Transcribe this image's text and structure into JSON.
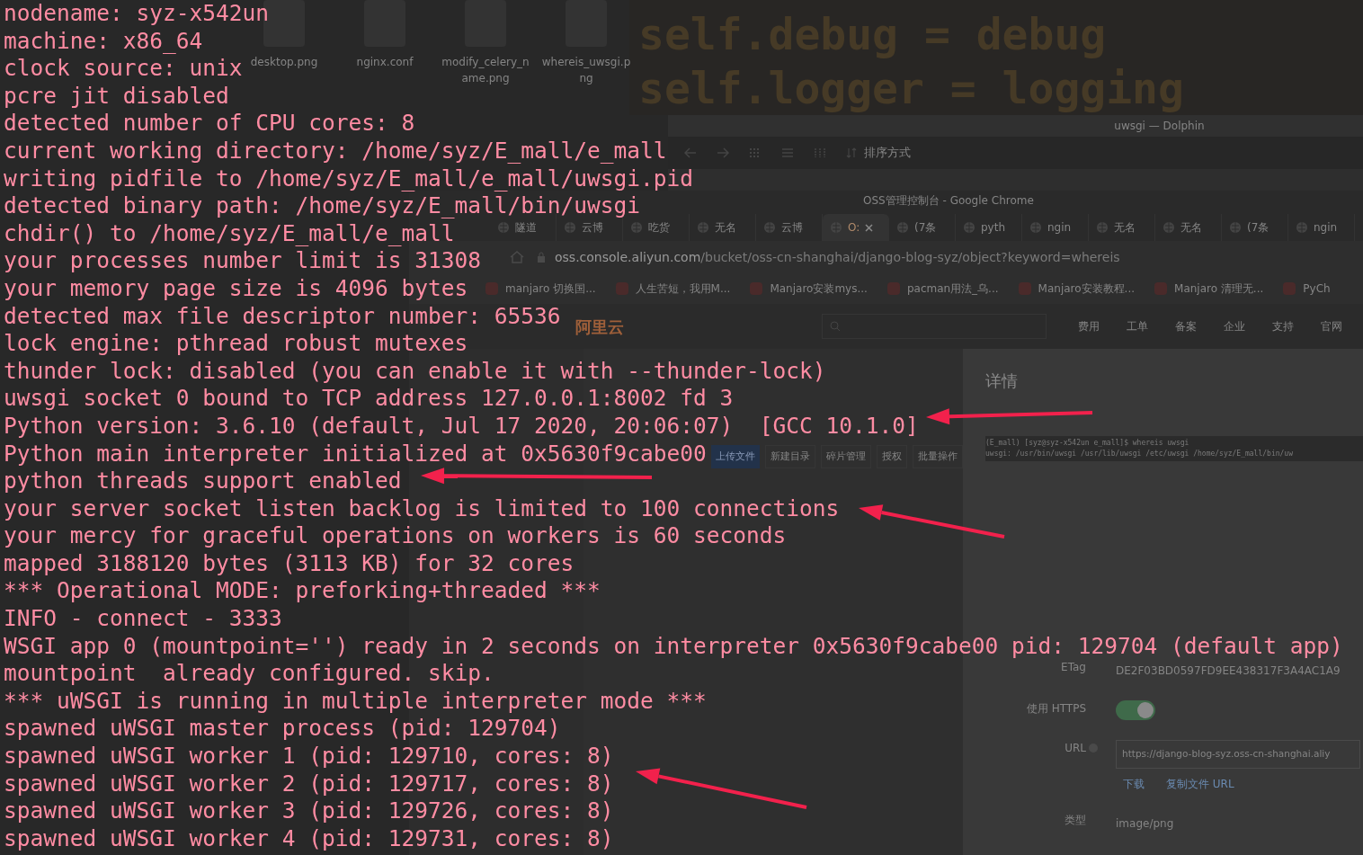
{
  "desktop": {
    "files": [
      {
        "name": "desktop.png"
      },
      {
        "name": "nginx.conf"
      },
      {
        "name": "modify_celery_name.png"
      },
      {
        "name": "whereis_uwsgi.png"
      }
    ]
  },
  "editor": {
    "code_lines": [
      "self.debug = debug",
      "self.logger = logging"
    ]
  },
  "file_manager": {
    "title": "uwsgi — Dolphin",
    "sort_label": "排序方式"
  },
  "browser": {
    "title": "OSS管理控制台 - Google Chrome",
    "tabs": [
      {
        "label": "隧道",
        "selected": false
      },
      {
        "label": "云博",
        "selected": false
      },
      {
        "label": "吃货",
        "selected": false
      },
      {
        "label": "无名",
        "selected": false
      },
      {
        "label": "云博",
        "selected": false
      },
      {
        "label": "O:",
        "selected": true
      },
      {
        "label": "(7条",
        "selected": false
      },
      {
        "label": "pyth",
        "selected": false
      },
      {
        "label": "ngin",
        "selected": false
      },
      {
        "label": "无名",
        "selected": false
      },
      {
        "label": "无名",
        "selected": false
      },
      {
        "label": "(7条",
        "selected": false
      },
      {
        "label": "ngin",
        "selected": false
      }
    ],
    "url_host": "oss.console.aliyun.com",
    "url_path": "/bucket/oss-cn-shanghai/django-blog-syz/object?keyword=whereis",
    "bookmarks": [
      "manjaro 切换国...",
      "人生苦短，我用M...",
      "Manjaro安装mys...",
      "pacman用法_乌...",
      "Manjaro安装教程...",
      "Manjaro 清理无...",
      "PyCh"
    ]
  },
  "console": {
    "logo": "阿里云",
    "nav": [
      "费用",
      "工单",
      "备案",
      "企业",
      "支持",
      "官网"
    ],
    "toolbar": [
      "上传文件",
      "新建目录",
      "碎片管理",
      "授权",
      "批量操作"
    ],
    "detail": {
      "title": "详情",
      "preview_lines": [
        "(E_mall) [syz@syz-x542un e_mall]$ whereis uwsgi",
        "uwsgi: /usr/bin/uwsgi /usr/lib/uwsgi /etc/uwsgi /home/syz/E_mall/bin/uw"
      ],
      "fields": [
        {
          "kind": "text",
          "label": "ETag",
          "value": "DE2F03BD0597FD9EE438317F3A4AC1A9"
        },
        {
          "kind": "toggle",
          "label": "使用 HTTPS",
          "on": true
        },
        {
          "kind": "url",
          "label": "URL",
          "value": "https://django-blog-syz.oss-cn-shanghai.aliy",
          "links": [
            "下载",
            "复制文件 URL"
          ]
        },
        {
          "kind": "text",
          "label": "类型",
          "value": "image/png"
        }
      ]
    }
  },
  "terminal": {
    "lines": [
      "nodename: syz-x542un",
      "machine: x86_64",
      "clock source: unix",
      "pcre jit disabled",
      "detected number of CPU cores: 8",
      "current working directory: /home/syz/E_mall/e_mall",
      "writing pidfile to /home/syz/E_mall/e_mall/uwsgi.pid",
      "detected binary path: /home/syz/E_mall/bin/uwsgi",
      "chdir() to /home/syz/E_mall/e_mall",
      "your processes number limit is 31308",
      "your memory page size is 4096 bytes",
      "detected max file descriptor number: 65536",
      "lock engine: pthread robust mutexes",
      "thunder lock: disabled (you can enable it with --thunder-lock)",
      "uwsgi socket 0 bound to TCP address 127.0.0.1:8002 fd 3",
      "Python version: 3.6.10 (default, Jul 17 2020, 20:06:07)  [GCC 10.1.0]",
      "Python main interpreter initialized at 0x5630f9cabe00",
      "python threads support enabled",
      "your server socket listen backlog is limited to 100 connections",
      "your mercy for graceful operations on workers is 60 seconds",
      "mapped 3188120 bytes (3113 KB) for 32 cores",
      "*** Operational MODE: preforking+threaded ***",
      "INFO - connect - 3333",
      "WSGI app 0 (mountpoint='') ready in 2 seconds on interpreter 0x5630f9cabe00 pid: 129704 (default app)",
      "mountpoint  already configured. skip.",
      "*** uWSGI is running in multiple interpreter mode ***",
      "spawned uWSGI master process (pid: 129704)",
      "spawned uWSGI worker 1 (pid: 129710, cores: 8)",
      "spawned uWSGI worker 2 (pid: 129717, cores: 8)",
      "spawned uWSGI worker 3 (pid: 129726, cores: 8)",
      "spawned uWSGI worker 4 (pid: 129731, cores: 8)"
    ]
  }
}
